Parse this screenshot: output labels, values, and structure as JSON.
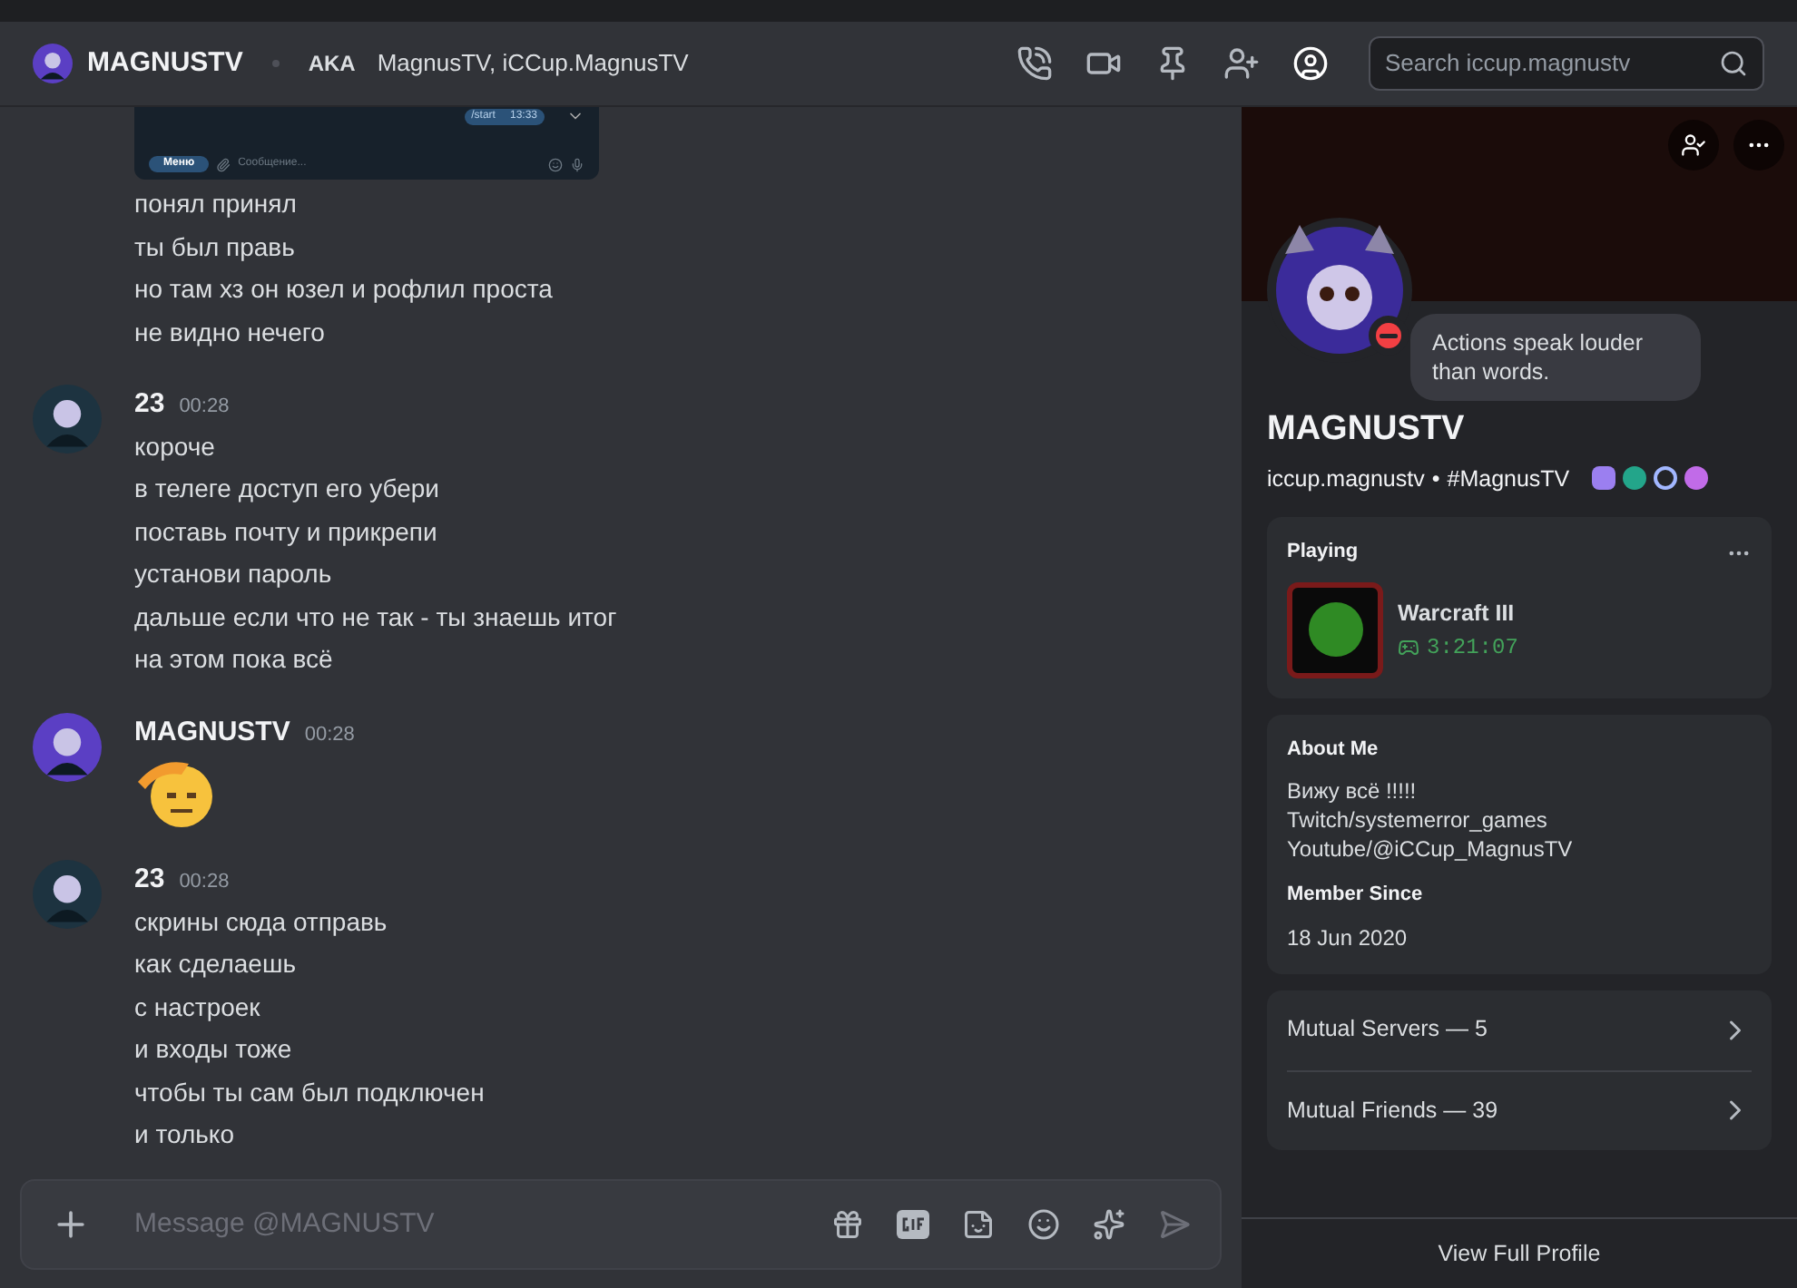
{
  "header": {
    "name": "MAGNUSTV",
    "aka_label": "AKA",
    "aka": "MagnusTV, iCCup.MagnusTV",
    "search": {
      "placeholder": "Search iccup.magnustv"
    }
  },
  "attachment": {
    "bubble_text": "/start",
    "bubble_time": "13:33",
    "menu_button": "Меню",
    "input_placeholder": "Сообщение..."
  },
  "messages": [
    {
      "kind": "continuation",
      "lines": [
        "понял принял",
        "ты был правь",
        "но там хз он юзел и рофлил проста",
        "не видно нечего"
      ]
    },
    {
      "kind": "group",
      "author": "23",
      "color": "#1d3340",
      "time": "00:28",
      "lines": [
        "короче",
        "в телеге доступ его убери",
        "поставь почту и прикрепи",
        "установи пароль",
        "дальше если что не так - ты знаешь итог",
        "на этом пока всё"
      ]
    },
    {
      "kind": "emoji",
      "author": "MAGNUSTV",
      "color": "#5b3fc4",
      "time": "00:28"
    },
    {
      "kind": "group",
      "author": "23",
      "color": "#1d3340",
      "time": "00:28",
      "lines": [
        "скрины сюда отправь",
        "как сделаешь",
        "с настроек",
        "и входы тоже",
        "чтобы ты сам был подключен",
        "и только"
      ]
    }
  ],
  "composer": {
    "placeholder": "Message @MAGNUSTV"
  },
  "profile": {
    "status_text": "Actions speak louder than words.",
    "display_name": "MAGNUSTV",
    "username": "iccup.magnustv",
    "separator": "•",
    "tag": "#MagnusTV",
    "activity": {
      "heading": "Playing",
      "game": "Warcraft III",
      "elapsed": "3:21:07"
    },
    "about": {
      "heading": "About Me",
      "lines": [
        "Вижу всё !!!!!",
        "Twitch/systemerror_games",
        "Youtube/@iCCup_MagnusTV"
      ]
    },
    "member_since": {
      "heading": "Member Since",
      "date": "18 Jun 2020"
    },
    "mutuals": [
      {
        "label": "Mutual Servers — 5"
      },
      {
        "label": "Mutual Friends — 39"
      }
    ],
    "footer_link": "View Full Profile"
  }
}
